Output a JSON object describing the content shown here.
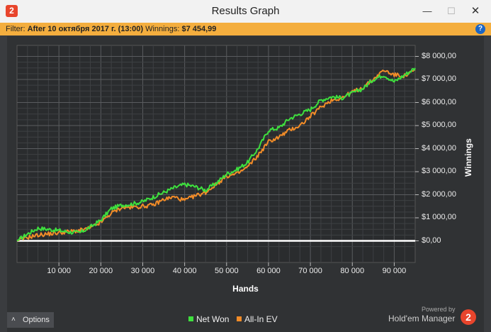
{
  "window": {
    "title": "Results Graph",
    "app_icon_glyph": "2",
    "minimize_glyph": "—",
    "maximize_glyph": "☐",
    "close_glyph": "✕"
  },
  "filter": {
    "prefix": "Filter: ",
    "value": "After 10 октября 2017 г. (13:00)",
    "winnings_label": " Winnings: ",
    "winnings_value": "$7 454,99",
    "help_glyph": "?"
  },
  "chart_data": {
    "type": "line",
    "xlabel": "Hands",
    "ylabel": "Winnings",
    "xlim": [
      0,
      95000
    ],
    "ylim": [
      -300,
      8200
    ],
    "x_ticks": [
      10000,
      20000,
      30000,
      40000,
      50000,
      60000,
      70000,
      80000,
      90000
    ],
    "x_tick_labels": [
      "10 000",
      "20 000",
      "30 000",
      "40 000",
      "50 000",
      "60 000",
      "70 000",
      "80 000",
      "90 000"
    ],
    "y_ticks": [
      0,
      1000,
      2000,
      3000,
      4000,
      5000,
      6000,
      7000,
      8000
    ],
    "y_tick_labels": [
      "$0,00",
      "$1 000,00",
      "$2 000,00",
      "$3 000,00",
      "$4 000,00",
      "$5 000,00",
      "$6 000,00",
      "$7 000,00",
      "$8 000,00"
    ],
    "grid": true,
    "legend_position": "bottom-center",
    "x": [
      0,
      2500,
      5000,
      7500,
      10000,
      12500,
      15000,
      17500,
      20000,
      22500,
      25000,
      27500,
      30000,
      32500,
      35000,
      37500,
      40000,
      42500,
      45000,
      47500,
      50000,
      52500,
      55000,
      57500,
      60000,
      62500,
      65000,
      67500,
      70000,
      72500,
      75000,
      77500,
      80000,
      82500,
      85000,
      87500,
      90000,
      92500,
      95000
    ],
    "series": [
      {
        "name": "Net Won",
        "color": "#3ee03e",
        "values": [
          0,
          300,
          550,
          500,
          450,
          380,
          350,
          600,
          900,
          1400,
          1550,
          1600,
          1700,
          1900,
          2100,
          2300,
          2450,
          2350,
          2200,
          2500,
          2900,
          3100,
          3400,
          4000,
          4800,
          4900,
          5300,
          5500,
          5700,
          6100,
          6250,
          6200,
          6400,
          6600,
          7000,
          7200,
          6900,
          7200,
          7500
        ]
      },
      {
        "name": "All-In EV",
        "color": "#f28c28",
        "values": [
          0,
          150,
          250,
          300,
          350,
          400,
          450,
          550,
          800,
          1200,
          1450,
          1450,
          1500,
          1550,
          1800,
          1900,
          1750,
          1950,
          2100,
          2450,
          2800,
          2900,
          3200,
          3700,
          4300,
          4500,
          4800,
          5000,
          5400,
          5800,
          6100,
          6200,
          6450,
          6650,
          7000,
          7400,
          7200,
          7150,
          7400
        ]
      }
    ]
  },
  "options": {
    "chevron_glyph": "˄",
    "label": "Options"
  },
  "footer": {
    "powered_by": "Powered by",
    "brand": "Hold'em Manager",
    "brand_logo_glyph": "2"
  }
}
